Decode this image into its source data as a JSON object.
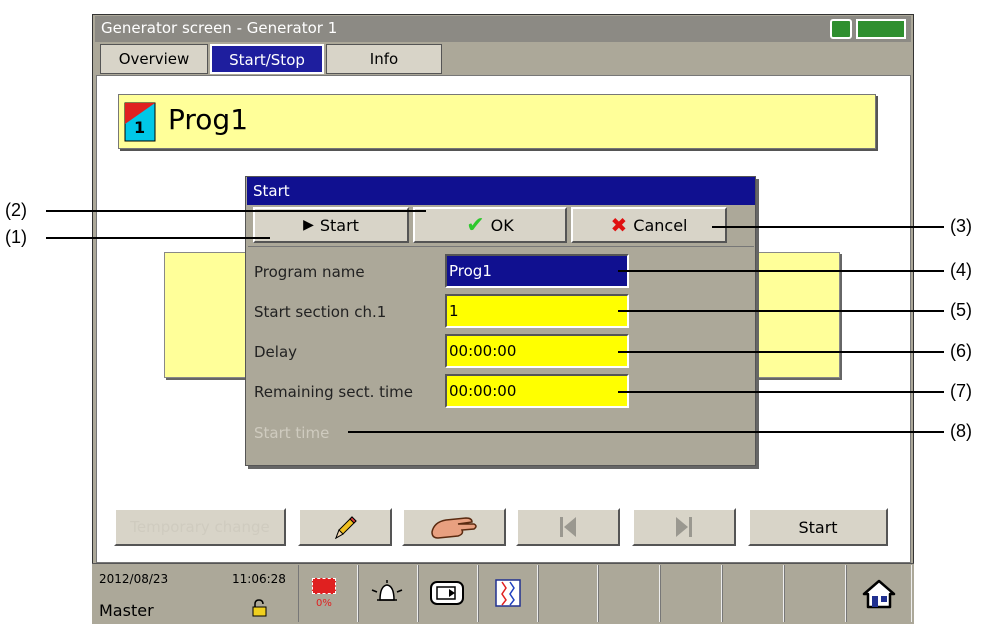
{
  "window": {
    "title": "Generator screen - Generator 1"
  },
  "tabs": [
    {
      "label": "Overview",
      "active": false
    },
    {
      "label": "Start/Stop",
      "active": true
    },
    {
      "label": "Info",
      "active": false
    }
  ],
  "program_banner": {
    "number": "1",
    "title": "Prog1"
  },
  "dialog": {
    "title": "Start",
    "buttons": {
      "start": "Start",
      "ok": "OK",
      "cancel": "Cancel"
    },
    "fields": [
      {
        "label": "Program name",
        "value": "Prog1"
      },
      {
        "label": "Start section ch.1",
        "value": "1"
      },
      {
        "label": "Delay",
        "value": "00:00:00"
      },
      {
        "label": "Remaining sect. time",
        "value": "00:00:00"
      },
      {
        "label": "Start time",
        "value": ""
      }
    ]
  },
  "bottom_buttons": {
    "temporary_change": "Temporary change",
    "start": "Start"
  },
  "status_bar": {
    "date": "2012/08/23",
    "time": "11:06:28",
    "user": "Master",
    "memory": "0%"
  },
  "callouts": [
    "(1)",
    "(2)",
    "(3)",
    "(4)",
    "(5)",
    "(6)",
    "(7)",
    "(8)"
  ],
  "colors": {
    "title_blue": "#101090",
    "field_yellow": "#ffff00",
    "banner_yellow": "#ffff99",
    "panel_grey": "#aca899"
  }
}
